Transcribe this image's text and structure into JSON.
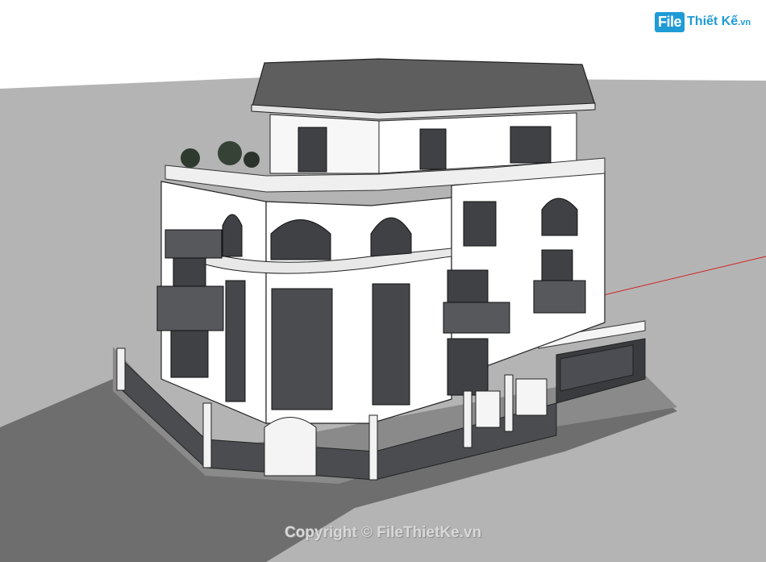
{
  "watermark": {
    "logo_part1": "File",
    "logo_part2": "Thiết Kế",
    "logo_suffix": ".vn",
    "copyright": "Copyright © FileThietKe.vn"
  },
  "colors": {
    "ground": "#b3b3b3",
    "road": "#707070",
    "roof": "#5e5e5e",
    "wall": "#ffffff",
    "window": "#3f4145",
    "axis_red": "#d22222",
    "logo_blue": "#1f9bd6"
  }
}
